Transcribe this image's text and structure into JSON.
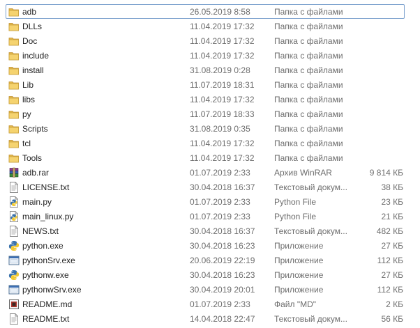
{
  "files": [
    {
      "name": "adb",
      "date": "26.05.2019 8:58",
      "type": "Папка с файлами",
      "size": "",
      "icon": "folder-icon",
      "focused": true
    },
    {
      "name": "DLLs",
      "date": "11.04.2019 17:32",
      "type": "Папка с файлами",
      "size": "",
      "icon": "folder-icon"
    },
    {
      "name": "Doc",
      "date": "11.04.2019 17:32",
      "type": "Папка с файлами",
      "size": "",
      "icon": "folder-icon"
    },
    {
      "name": "include",
      "date": "11.04.2019 17:32",
      "type": "Папка с файлами",
      "size": "",
      "icon": "folder-icon"
    },
    {
      "name": "install",
      "date": "31.08.2019 0:28",
      "type": "Папка с файлами",
      "size": "",
      "icon": "folder-icon"
    },
    {
      "name": "Lib",
      "date": "11.07.2019 18:31",
      "type": "Папка с файлами",
      "size": "",
      "icon": "folder-icon"
    },
    {
      "name": "libs",
      "date": "11.04.2019 17:32",
      "type": "Папка с файлами",
      "size": "",
      "icon": "folder-icon"
    },
    {
      "name": "py",
      "date": "11.07.2019 18:33",
      "type": "Папка с файлами",
      "size": "",
      "icon": "folder-icon"
    },
    {
      "name": "Scripts",
      "date": "31.08.2019 0:35",
      "type": "Папка с файлами",
      "size": "",
      "icon": "folder-icon"
    },
    {
      "name": "tcl",
      "date": "11.04.2019 17:32",
      "type": "Папка с файлами",
      "size": "",
      "icon": "folder-icon"
    },
    {
      "name": "Tools",
      "date": "11.04.2019 17:32",
      "type": "Папка с файлами",
      "size": "",
      "icon": "folder-icon"
    },
    {
      "name": "adb.rar",
      "date": "01.07.2019 2:33",
      "type": "Архив WinRAR",
      "size": "9 814 КБ",
      "icon": "winrar-archive-icon"
    },
    {
      "name": "LICENSE.txt",
      "date": "30.04.2018 16:37",
      "type": "Текстовый докум...",
      "size": "38 КБ",
      "icon": "text-file-icon"
    },
    {
      "name": "main.py",
      "date": "01.07.2019 2:33",
      "type": "Python File",
      "size": "23 КБ",
      "icon": "python-file-icon"
    },
    {
      "name": "main_linux.py",
      "date": "01.07.2019 2:33",
      "type": "Python File",
      "size": "21 КБ",
      "icon": "python-file-icon"
    },
    {
      "name": "NEWS.txt",
      "date": "30.04.2018 16:37",
      "type": "Текстовый докум...",
      "size": "482 КБ",
      "icon": "text-file-icon"
    },
    {
      "name": "python.exe",
      "date": "30.04.2018 16:23",
      "type": "Приложение",
      "size": "27 КБ",
      "icon": "python-exe-icon"
    },
    {
      "name": "pythonSrv.exe",
      "date": "20.06.2019 22:19",
      "type": "Приложение",
      "size": "112 КБ",
      "icon": "application-icon"
    },
    {
      "name": "pythonw.exe",
      "date": "30.04.2018 16:23",
      "type": "Приложение",
      "size": "27 КБ",
      "icon": "python-exe-icon"
    },
    {
      "name": "pythonwSrv.exe",
      "date": "30.04.2019 20:01",
      "type": "Приложение",
      "size": "112 КБ",
      "icon": "application-icon"
    },
    {
      "name": "README.md",
      "date": "01.07.2019 2:33",
      "type": "Файл \"MD\"",
      "size": "2 КБ",
      "icon": "md-file-icon"
    },
    {
      "name": "README.txt",
      "date": "14.04.2018 22:47",
      "type": "Текстовый докум...",
      "size": "56 КБ",
      "icon": "text-file-icon"
    }
  ]
}
